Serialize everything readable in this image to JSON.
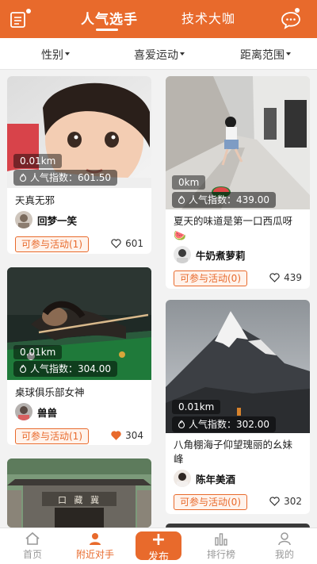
{
  "header": {
    "tabs": [
      {
        "label": "人气选手",
        "active": true
      },
      {
        "label": "技术大咖",
        "active": false
      }
    ],
    "accent_color": "#e86a2c"
  },
  "filters": [
    {
      "label": "性别"
    },
    {
      "label": "喜爱运动"
    },
    {
      "label": "距离范围"
    }
  ],
  "cards": [
    {
      "distance": "0.01km",
      "popularity": "人气指数：601.50",
      "title": "天真无邪",
      "user": "回梦一笑",
      "activity": "可参与活动(1)",
      "likes": "601",
      "liked": false
    },
    {
      "distance": "0km",
      "popularity": "人气指数：439.00",
      "title": "夏天的味道是第一口西瓜呀🍉",
      "user": "牛奶煮萝莉",
      "activity": "可参与活动(0)",
      "likes": "439",
      "liked": false
    },
    {
      "distance": "0.01km",
      "popularity": "人气指数：304.00",
      "title": "桌球俱乐部女神",
      "user": "兽兽",
      "activity": "可参与活动(1)",
      "likes": "304",
      "liked": true
    },
    {
      "distance": "0.01km",
      "popularity": "人气指数：302.00",
      "title": "八角棚海子仰望瑰丽的幺妹峰",
      "user": "陈年美酒",
      "activity": "可参与活动(0)",
      "likes": "302",
      "liked": false
    },
    {
      "sign": "口 藏 冀"
    }
  ],
  "bottom_nav": {
    "home": "首页",
    "nearby": "附近对手",
    "publish": "发布",
    "ranking": "排行榜",
    "mine": "我的"
  }
}
